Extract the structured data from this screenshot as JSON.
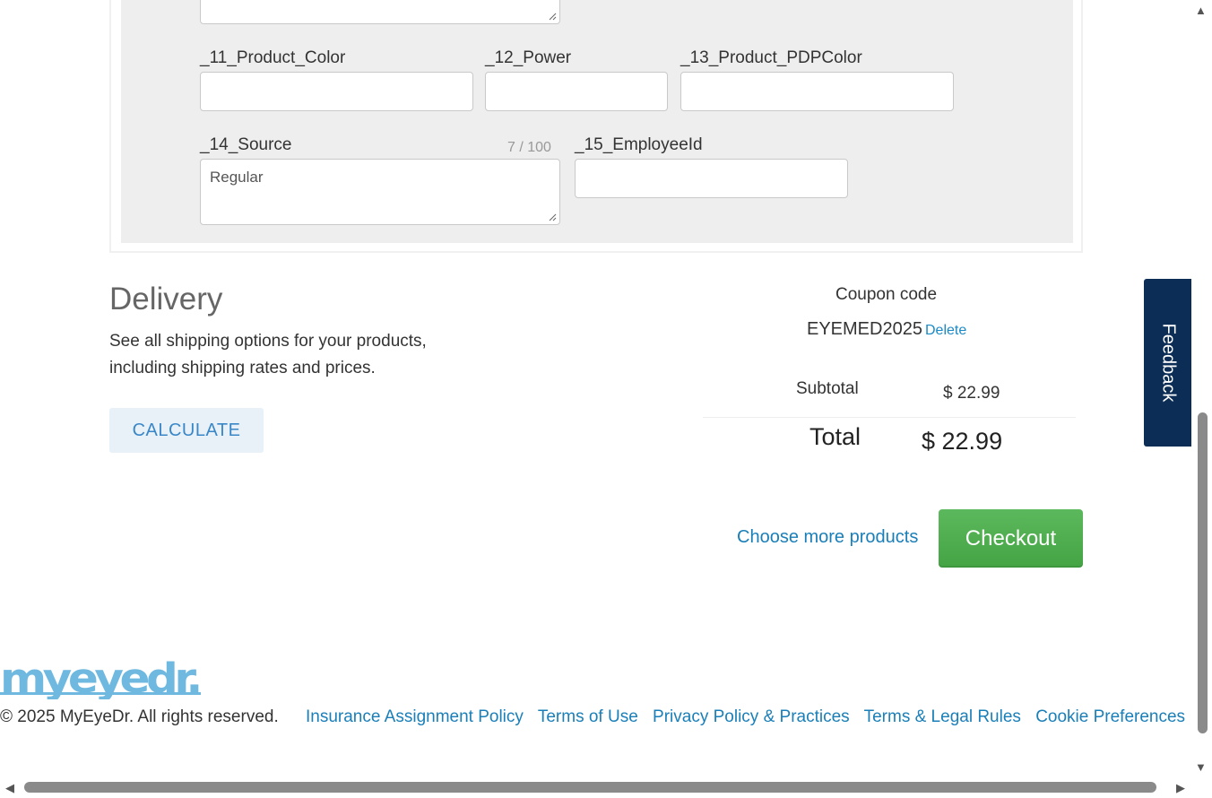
{
  "form": {
    "field11_label": "_11_Product_Color",
    "field11_value": "",
    "field12_label": "_12_Power",
    "field12_value": "",
    "field13_label": "_13_Product_PDPColor",
    "field13_value": "",
    "field14_label": "_14_Source",
    "field14_value": "Regular",
    "field14_counter": "7 / 100",
    "field15_label": "_15_EmployeeId",
    "field15_value": ""
  },
  "delivery": {
    "title": "Delivery",
    "description": "See all shipping options for your products, including shipping rates and prices.",
    "calculate_label": "CALCULATE"
  },
  "summary": {
    "coupon_label": "Coupon code",
    "coupon_code": "EYEMED2025",
    "delete_label": "Delete",
    "subtotal_label": "Subtotal",
    "subtotal_value": "$ 22.99",
    "total_label": "Total",
    "total_value": "$ 22.99"
  },
  "actions": {
    "more_products_label": "Choose more products",
    "checkout_label": "Checkout"
  },
  "feedback_label": "Feedback",
  "footer": {
    "logo_text": "myeyedr.",
    "copyright": "© 2025 MyEyeDr. All rights reserved.",
    "links": [
      "Insurance Assignment Policy",
      "Terms of Use",
      "Privacy Policy & Practices",
      "Terms & Legal Rules",
      "Cookie Preferences"
    ]
  },
  "colors": {
    "link": "#1a7fb8",
    "checkout": "#4cae4c",
    "feedback_bg": "#0c2d55",
    "logo": "#6fb8e0"
  },
  "icons": [
    "resize-handle-icon",
    "scroll-up-icon",
    "scroll-down-icon",
    "scroll-left-icon",
    "scroll-right-icon"
  ]
}
